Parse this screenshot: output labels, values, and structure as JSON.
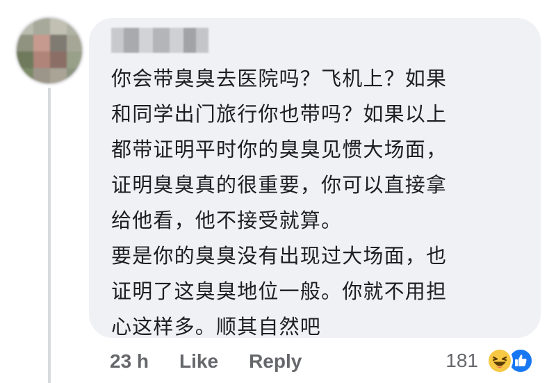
{
  "comment": {
    "author_name": "",
    "text_lines": [
      "你会带臭臭去医院吗？飞机上？如果",
      "和同学出门旅行你也带吗？如果以上",
      "都带证明平时你的臭臭见惯大场面，",
      "证明臭臭真的很重要，你可以直接拿",
      "给他看，他不接受就算。",
      "要是你的臭臭没有出现过大场面，也",
      "证明了这臭臭地位一般。你就不用担",
      "心这样多。顺其自然吧"
    ]
  },
  "actions": {
    "timestamp": "23 h",
    "like_label": "Like",
    "reply_label": "Reply"
  },
  "reactions": {
    "count": "181",
    "types": [
      "haha-icon",
      "like-icon"
    ]
  },
  "colors": {
    "bubble": "#eff1f5",
    "meta_text": "#65676b",
    "like_blue": "#1877f2",
    "haha_yellow": "#f7c843"
  }
}
